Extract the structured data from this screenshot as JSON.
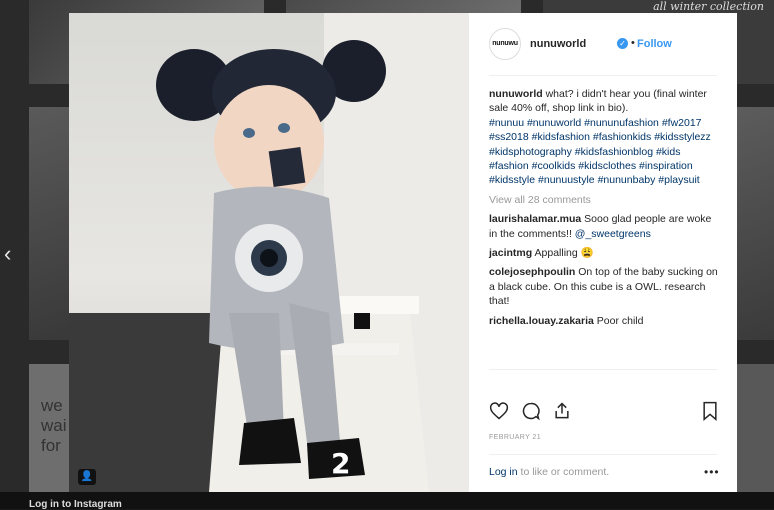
{
  "background": {
    "tile_text_top": "all winter collection",
    "tile_text_left": "we\nwai\nfor",
    "footer_text": "Log in to Instagram"
  },
  "post": {
    "username": "nunuworld",
    "avatar_text": "nunuwu",
    "follow_label": "Follow",
    "dot": "•",
    "caption_user": "nunuworld",
    "caption_text": " what? i didn't hear you (final winter sale 40% off, shop link in bio).",
    "hashtags": "#nunuu #nunuworld #nununufashion #fw2017 #ss2018 #kidsfashion #fashionkids #kidsstylezz #kidsphotography #kidsfashionblog #kids #fashion #coolkids #kidsclothes #inspiration #kidsstyle #nunuustyle #nununbaby #playsuit",
    "view_all": "View all 28 comments",
    "comments": [
      {
        "user": "laurishalamar.mua",
        "text": " Sooo glad people are woke in the comments!! ",
        "mention": "@_sweetgreens"
      },
      {
        "user": "jacintmg",
        "text": " Appalling 😩",
        "mention": ""
      },
      {
        "user": "colejosephpoulin",
        "text": " On top of the baby sucking on a black cube. On this cube is a OWL. research that!",
        "mention": ""
      },
      {
        "user": "richella.louay.zakaria",
        "text": " Poor child",
        "mention": ""
      }
    ],
    "date": "FEBRUARY 21",
    "login_link": "Log in",
    "login_text": " to like or comment.",
    "more_icon": "•••"
  },
  "icons": {
    "verified": "✓",
    "prev": "‹",
    "user_badge": "👤"
  },
  "colors": {
    "accent": "#3897f0",
    "link": "#003569",
    "muted": "#999999"
  }
}
